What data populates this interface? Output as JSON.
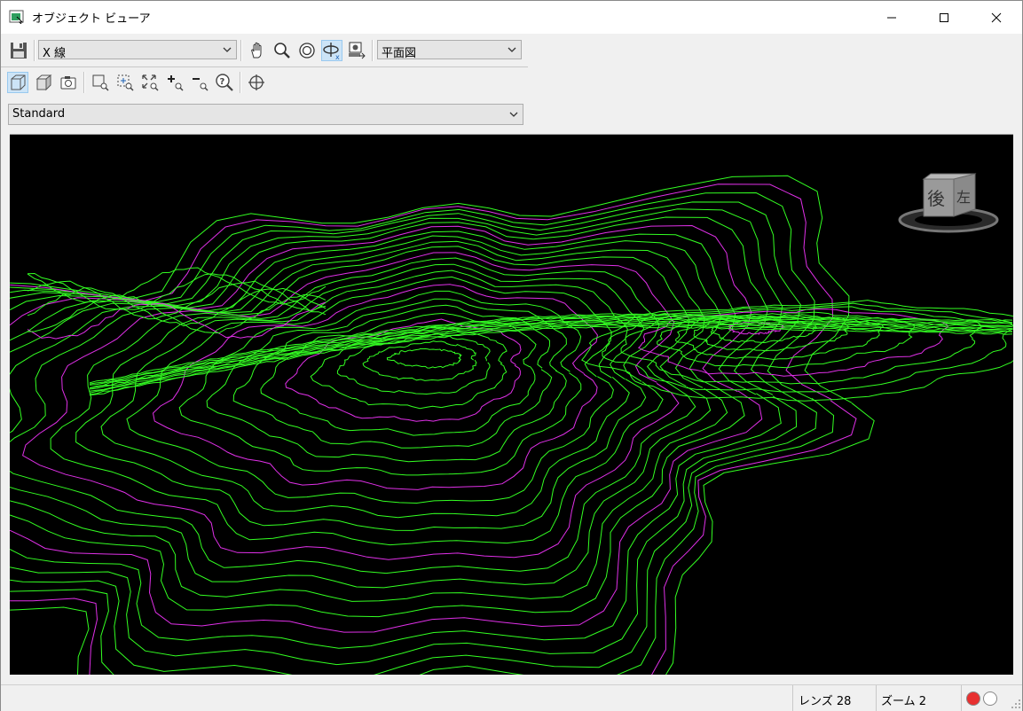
{
  "window": {
    "title": "オブジェクト ビューア"
  },
  "toolbar": {
    "layer_combo_value": "X 線",
    "view_combo_value": "平面図",
    "style_combo_value": "Standard",
    "active_tool": "orbit-x",
    "active_view_mode": "wireframe"
  },
  "viewcube": {
    "face_back": "後",
    "face_left": "左"
  },
  "status": {
    "lens": "レンズ 28",
    "zoom": "ズーム 2",
    "indicator_on_color": "#e83030",
    "indicator_off_color": "#ffffff"
  },
  "colors": {
    "viewport_bg": "#000000",
    "contour_green": "#33ff22",
    "contour_magenta": "#e030e8",
    "active_button_bg": "#cce4f7"
  }
}
